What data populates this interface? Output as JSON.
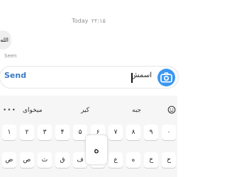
{
  "chat": {
    "timestamp_day": "Today",
    "timestamp_time": "۲۲:۱۵",
    "bubble_text": "الله",
    "seen_label": "Seen"
  },
  "composer": {
    "send_label": "Send",
    "message_value": "اسمش",
    "camera_icon": "camera-icon"
  },
  "keyboard": {
    "menu_dots": "•••",
    "suggestions": [
      "میخوای",
      "کیر",
      "جبه"
    ],
    "emoji_icon": "emoji-icon",
    "number_row": [
      "۱",
      "۲",
      "۳",
      "۴",
      "۵",
      "۶",
      "۷",
      "۸",
      "۹",
      "۰"
    ],
    "letter_row": [
      "ض",
      "ص",
      "ث",
      "ق",
      "ف",
      "غ",
      "ع",
      "ه",
      "خ",
      "ح"
    ],
    "popup_key": "ه"
  }
}
